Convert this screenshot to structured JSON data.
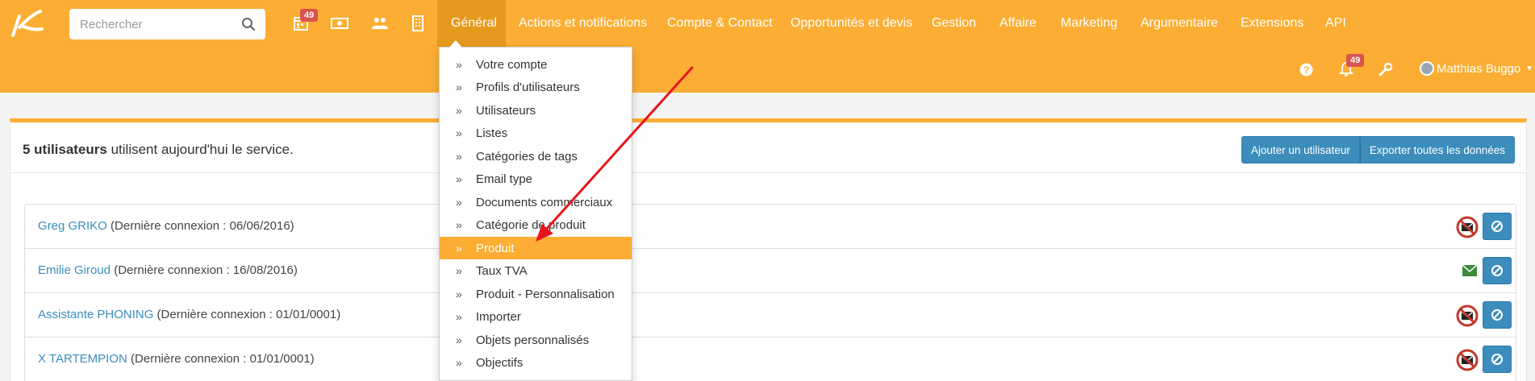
{
  "search": {
    "placeholder": "Rechercher"
  },
  "quick_icons": [
    {
      "icon": "calendar-icon",
      "badge": "49"
    },
    {
      "icon": "money-icon"
    },
    {
      "icon": "users-icon"
    },
    {
      "icon": "building-icon"
    }
  ],
  "menu": [
    {
      "label": "Général",
      "active": true
    },
    {
      "label": "Actions et notifications"
    },
    {
      "label": "Compte & Contact"
    },
    {
      "label": "Opportunités et devis"
    },
    {
      "label": "Gestion"
    },
    {
      "label": "Affaire"
    },
    {
      "label": "Marketing"
    },
    {
      "label": "Argumentaire"
    },
    {
      "label": "Extensions"
    },
    {
      "label": "API"
    }
  ],
  "right_tools": {
    "help_icon": "question-icon",
    "notifications_icon": "bell-icon",
    "notifications_badge": "49",
    "settings_icon": "wrench-icon",
    "user_name": "Matthias Buggo"
  },
  "panel": {
    "count_bold": "5 utilisateurs",
    "count_rest": " utilisent aujourd'hui le service.",
    "add_user": "Ajouter un utilisateur",
    "export_all": "Exporter toutes les données"
  },
  "users": [
    {
      "name": "Greg GRIKO",
      "last_login": "(Dernière connexion : 06/06/2016)",
      "mail_status": "mail-blocked-icon"
    },
    {
      "name": "Emilie Giroud",
      "last_login": "(Dernière connexion : 16/08/2016)",
      "mail_status": "mail-ok-icon"
    },
    {
      "name": "Assistante PHONING",
      "last_login": "(Dernière connexion : 01/01/0001)",
      "mail_status": "mail-blocked-icon"
    },
    {
      "name": "X TARTEMPION",
      "last_login": "(Dernière connexion : 01/01/0001)",
      "mail_status": "mail-blocked-icon"
    }
  ],
  "dropdown": {
    "items": [
      {
        "label": "Votre compte"
      },
      {
        "label": "Profils d'utilisateurs"
      },
      {
        "label": "Utilisateurs"
      },
      {
        "label": "Listes"
      },
      {
        "label": "Catégories de tags"
      },
      {
        "label": "Email type"
      },
      {
        "label": "Documents commerciaux"
      },
      {
        "label": "Catégorie de produit"
      },
      {
        "label": "Produit",
        "active": true
      },
      {
        "label": "Taux TVA"
      },
      {
        "label": "Produit - Personnalisation"
      },
      {
        "label": "Importer"
      },
      {
        "label": "Objets personnalisés"
      },
      {
        "label": "Objectifs"
      }
    ]
  },
  "colors": {
    "brand": "#fbae33",
    "active_menu": "#e59a1e",
    "button": "#3c8dbc",
    "link": "#3c8dbc",
    "badge": "#d9534f",
    "annotation_arrow": "#e8141b"
  }
}
